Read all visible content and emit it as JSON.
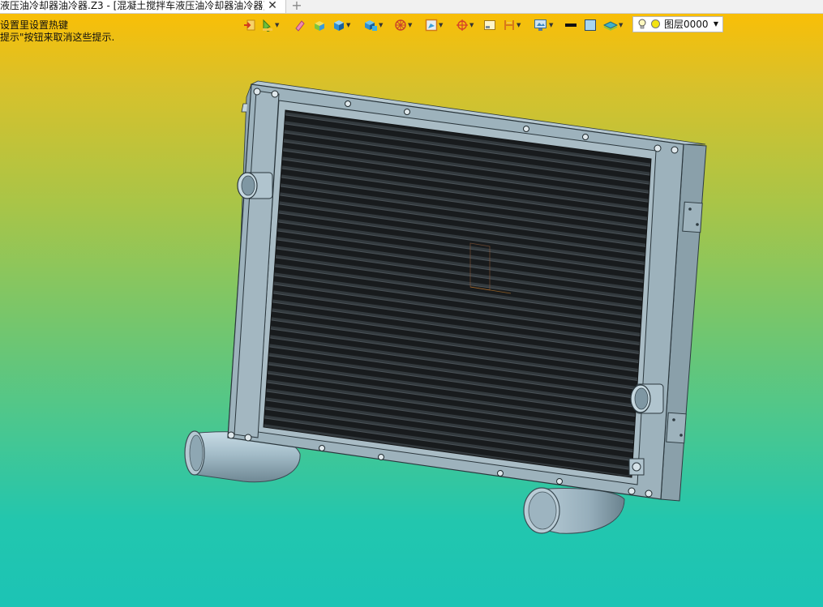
{
  "tab": {
    "title": "液压油冷却器油冷器.Z3 - [混凝土搅拌车液压油冷却器油冷器]",
    "close_glyph": "✕",
    "new_glyph": "+"
  },
  "hints": [
    "设置里设置热键",
    "提示\"按钮来取消这些提示."
  ],
  "toolbar": {
    "icons": [
      "exit-icon",
      "pick-filter-icon",
      "eraser-icon",
      "shade-icon",
      "solid-view-icon",
      "render-mode-icon",
      "wire-wheel-icon",
      "view-frame-icon",
      "snap-target-icon",
      "window-icon",
      "section-icon",
      "display-icon",
      "line-color-icon",
      "fill-color-icon",
      "layer-stack-icon"
    ],
    "layer": {
      "name": "图层0000",
      "icon": "bulb-icon",
      "color": "#f3e312"
    }
  },
  "colors": {
    "frame": "#9db2bc",
    "core": "#1e2224",
    "bg_top": "#ffbe00",
    "bg_bottom": "#1cc4b5"
  }
}
